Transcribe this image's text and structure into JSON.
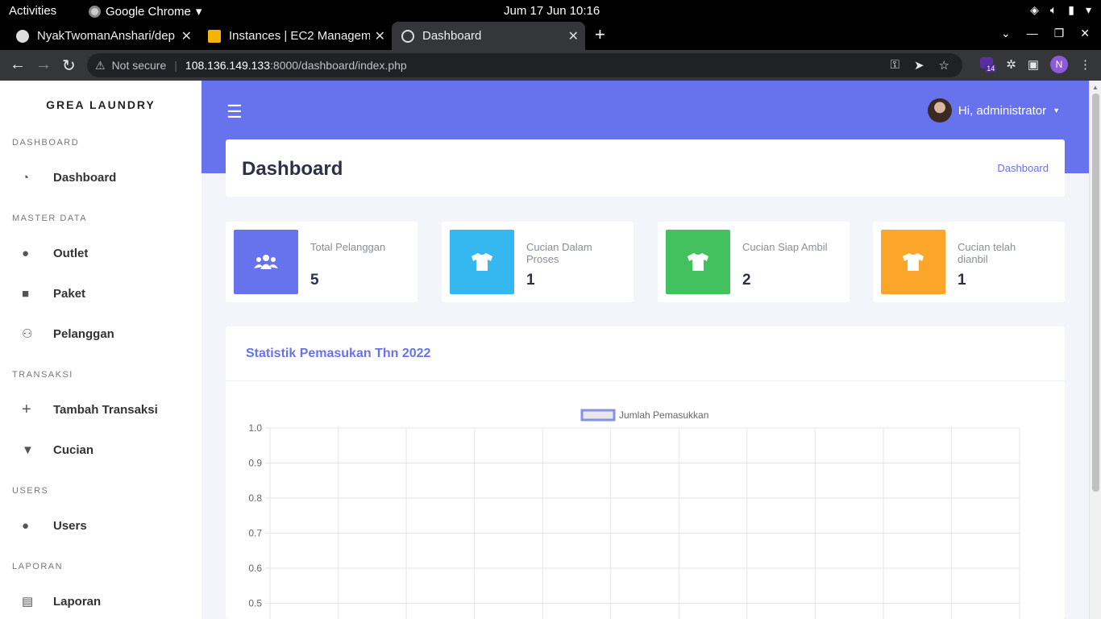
{
  "os_bar": {
    "activities": "Activities",
    "app_name": "Google Chrome",
    "clock": "Jum 17 Jun  10:16"
  },
  "browser": {
    "tabs": [
      {
        "title": "NyakTwomanAnshari/dep",
        "active": false
      },
      {
        "title": "Instances | EC2 Manageme",
        "active": false
      },
      {
        "title": "Dashboard",
        "active": true
      }
    ],
    "security_label": "Not secure",
    "url_host": "108.136.149.133",
    "url_rest": ":8000/dashboard/index.php",
    "profile_initial": "N",
    "extension_badge": "14"
  },
  "sidebar": {
    "brand": "GREA LAUNDRY",
    "sections": [
      {
        "heading": "DASHBOARD",
        "items": [
          {
            "label": "Dashboard",
            "icon": "gauge-icon"
          }
        ]
      },
      {
        "heading": "MASTER DATA",
        "items": [
          {
            "label": "Outlet",
            "icon": "fire-icon"
          },
          {
            "label": "Paket",
            "icon": "box-icon"
          },
          {
            "label": "Pelanggan",
            "icon": "users-icon"
          }
        ]
      },
      {
        "heading": "TRANSAKSI",
        "items": [
          {
            "label": "Tambah Transaksi",
            "icon": "plus-icon"
          },
          {
            "label": "Cucian",
            "icon": "shirt-icon"
          }
        ]
      },
      {
        "heading": "USERS",
        "items": [
          {
            "label": "Users",
            "icon": "user-icon"
          }
        ]
      },
      {
        "heading": "LAPORAN",
        "items": [
          {
            "label": "Laporan",
            "icon": "file-icon"
          }
        ]
      }
    ]
  },
  "header": {
    "greeting": "Hi, administrator"
  },
  "page": {
    "title": "Dashboard",
    "breadcrumb": "Dashboard"
  },
  "stats": [
    {
      "label": "Total Pelanggan",
      "value": "5",
      "color": "#6772ed",
      "icon": "users-icon"
    },
    {
      "label": "Cucian Dalam Proses",
      "value": "1",
      "color": "#35b8f0",
      "icon": "shirt-icon"
    },
    {
      "label": "Cucian Siap Ambil",
      "value": "2",
      "color": "#44c15f",
      "icon": "shirt-icon"
    },
    {
      "label": "Cucian telah dianbil",
      "value": "1",
      "color": "#fca52b",
      "icon": "shirt-icon"
    }
  ],
  "chart_section": {
    "title": "Statistik Pemasukan Thn 2022"
  },
  "chart_data": {
    "type": "bar",
    "title": "",
    "xlabel": "",
    "ylabel": "",
    "series": [
      {
        "name": "Jumlah Pemasukkan",
        "values": []
      }
    ],
    "y_ticks": [
      "1.0",
      "0.9",
      "0.8",
      "0.7",
      "0.6",
      "0.5"
    ],
    "ylim": [
      0,
      1.0
    ],
    "x_gridlines": 11,
    "legend": "top-center",
    "grid": true,
    "legend_color": "#8790e6"
  }
}
